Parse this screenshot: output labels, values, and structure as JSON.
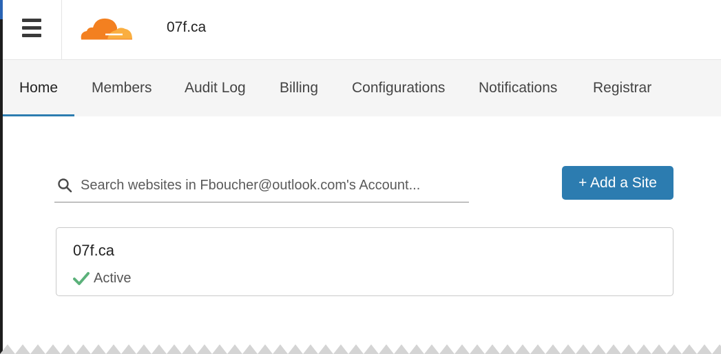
{
  "header": {
    "account_name": "07f.ca",
    "menu_icon": "hamburger-icon",
    "logo": "cloudflare-logo",
    "brand_colors": {
      "orange": "#f38020",
      "light_orange": "#faae40"
    }
  },
  "nav": {
    "tabs": [
      {
        "label": "Home",
        "active": true
      },
      {
        "label": "Members",
        "active": false
      },
      {
        "label": "Audit Log",
        "active": false
      },
      {
        "label": "Billing",
        "active": false
      },
      {
        "label": "Configurations",
        "active": false
      },
      {
        "label": "Notifications",
        "active": false
      },
      {
        "label": "Registrar",
        "active": false
      }
    ],
    "accent_color": "#2c7cb0"
  },
  "search": {
    "icon": "search-icon",
    "placeholder": "Search websites in Fboucher@outlook.com's Account...",
    "value": ""
  },
  "actions": {
    "add_site_label": "+ Add a Site",
    "button_color": "#2c7cb0"
  },
  "sites": [
    {
      "name": "07f.ca",
      "status": "Active",
      "status_icon": "check-icon",
      "status_color": "#5bb17a"
    }
  ]
}
